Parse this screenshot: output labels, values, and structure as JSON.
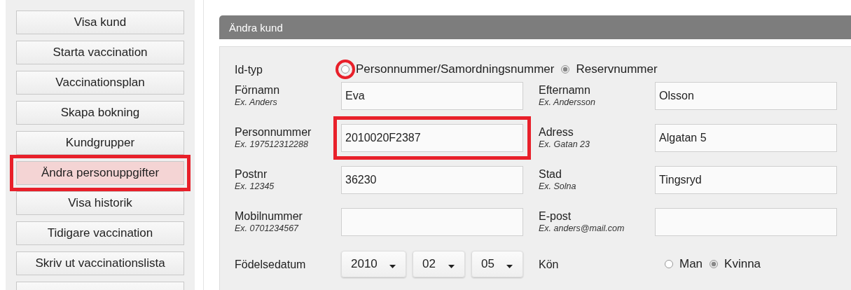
{
  "sidebar": {
    "items": [
      {
        "label": "Visa kund",
        "selected": false,
        "highlighted": false
      },
      {
        "label": "Starta vaccination",
        "selected": false,
        "highlighted": false
      },
      {
        "label": "Vaccinationsplan",
        "selected": false,
        "highlighted": false
      },
      {
        "label": "Skapa bokning",
        "selected": false,
        "highlighted": false
      },
      {
        "label": "Kundgrupper",
        "selected": false,
        "highlighted": false
      },
      {
        "label": "Ändra personuppgifter",
        "selected": true,
        "highlighted": true
      },
      {
        "label": "Visa historik",
        "selected": false,
        "highlighted": false
      },
      {
        "label": "Tidigare vaccination",
        "selected": false,
        "highlighted": false
      },
      {
        "label": "Skriv ut vaccinationslista",
        "selected": false,
        "highlighted": false
      },
      {
        "selected": false,
        "highlighted": false
      }
    ]
  },
  "form": {
    "title": "Ändra kund",
    "id_type": {
      "label": "Id-typ",
      "options": [
        {
          "label": "Personnummer/Samordningsnummer",
          "selected": false,
          "highlighted": true
        },
        {
          "label": "Reservnummer",
          "selected": true,
          "highlighted": false
        }
      ]
    },
    "rows": [
      [
        {
          "label": "Förnamn",
          "hint": "Ex. Anders",
          "value": "Eva",
          "highlighted": false
        },
        {
          "label": "Efternamn",
          "hint": "Ex. Andersson",
          "value": "Olsson",
          "highlighted": false
        }
      ],
      [
        {
          "label": "Personnummer",
          "hint": "Ex. 197512312288",
          "value": "2010020F2387",
          "highlighted": true
        },
        {
          "label": "Adress",
          "hint": "Ex. Gatan 23",
          "value": "Algatan 5",
          "highlighted": false
        }
      ],
      [
        {
          "label": "Postnr",
          "hint": "Ex. 12345",
          "value": "36230",
          "highlighted": false
        },
        {
          "label": "Stad",
          "hint": "Ex. Solna",
          "value": "Tingsryd",
          "highlighted": false
        }
      ],
      [
        {
          "label": "Mobilnummer",
          "hint": "Ex. 0701234567",
          "highlighted": false
        },
        {
          "label": "E-post",
          "hint": "Ex. anders@mail.com",
          "highlighted": false
        }
      ]
    ],
    "birthdate": {
      "label": "Födelsedatum",
      "parts": [
        "2010",
        "02",
        "05"
      ]
    },
    "gender": {
      "label": "Kön",
      "options": [
        {
          "label": "Man",
          "selected": false,
          "highlighted": false
        },
        {
          "label": "Kvinna",
          "selected": true,
          "highlighted": false
        }
      ]
    }
  }
}
